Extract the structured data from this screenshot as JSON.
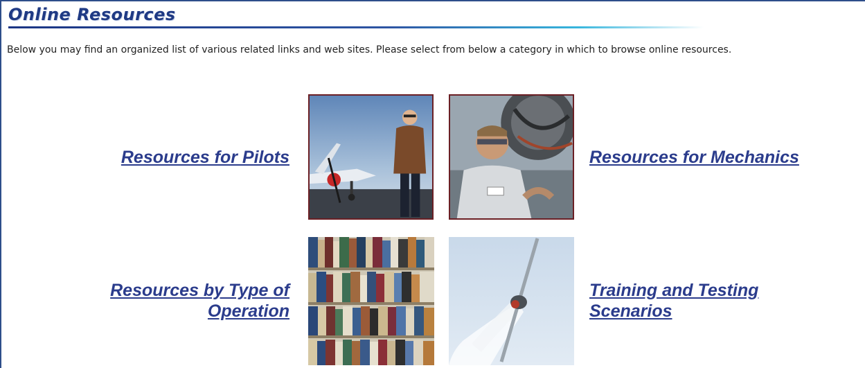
{
  "header": {
    "title": "Online Resources"
  },
  "intro": {
    "text": "Below you may find an organized list of various related links and web sites. Please select from below a category in which to browse online resources."
  },
  "categories": [
    {
      "label": "Resources for Pilots",
      "image": "pilot-with-airplane-photo"
    },
    {
      "label": "Resources for Mechanics",
      "image": "mechanic-with-engine-photo"
    },
    {
      "label": "Resources by Type of Operation",
      "image": "library-bookshelf-photo"
    },
    {
      "label": "Training and Testing Scenarios",
      "image": "aerobatic-plane-smoke-photo"
    }
  ],
  "colors": {
    "link": "#2b3c8c",
    "title": "#1f3a84",
    "photo_border": "#6b1f24"
  }
}
